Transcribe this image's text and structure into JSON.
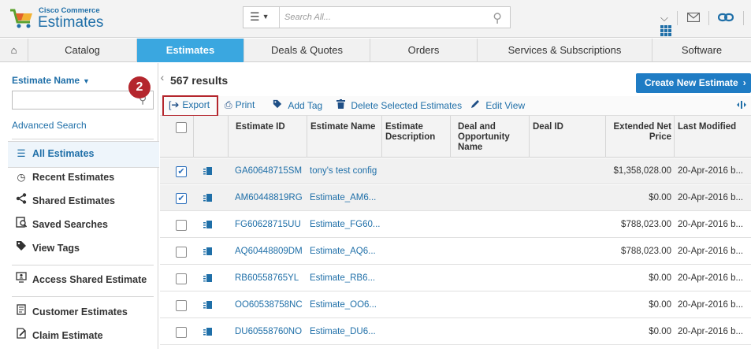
{
  "header": {
    "brand_small": "Cisco Commerce",
    "brand_title": "Estimates",
    "search_placeholder": "Search All..."
  },
  "nav": [
    "Catalog",
    "Estimates",
    "Deals & Quotes",
    "Orders",
    "Services & Subscriptions",
    "Software"
  ],
  "nav_active": "Estimates",
  "sidebar": {
    "filter_label": "Estimate Name",
    "advanced_search": "Advanced Search",
    "items": [
      {
        "label": "All Estimates",
        "icon": "list-icon"
      },
      {
        "label": "Recent Estimates",
        "icon": "clock-icon"
      },
      {
        "label": "Shared Estimates",
        "icon": "share-icon"
      },
      {
        "label": "Saved Searches",
        "icon": "saved-search-icon"
      },
      {
        "label": "View Tags",
        "icon": "tag-icon"
      },
      {
        "label": "Access Shared Estimate",
        "icon": "monitor-user-icon"
      },
      {
        "label": "Customer Estimates",
        "icon": "document-icon"
      },
      {
        "label": "Claim Estimate",
        "icon": "claim-icon"
      }
    ]
  },
  "results": {
    "count": "567 results",
    "create_button": "Create New Estimate",
    "step_badge": "2"
  },
  "toolbar": {
    "export": "Export",
    "print": "Print",
    "add_tag": "Add Tag",
    "delete": "Delete Selected Estimates",
    "edit_view": "Edit View"
  },
  "table": {
    "headers": {
      "estimate_id": "Estimate ID",
      "estimate_name": "Estimate Name",
      "estimate_description": "Estimate Description",
      "deal_opportunity": "Deal and Opportunity Name",
      "deal_id": "Deal ID",
      "net_price": "Extended Net Price",
      "last_modified": "Last Modified"
    },
    "rows": [
      {
        "id": "GA60648715SM",
        "name": "tony's test config",
        "price": "$1,358,028.00",
        "modified": "20-Apr-2016 b...",
        "checked": true
      },
      {
        "id": "AM60448819RG",
        "name": "Estimate_AM6...",
        "price": "$0.00",
        "modified": "20-Apr-2016 b...",
        "checked": true
      },
      {
        "id": "FG60628715UU",
        "name": "Estimate_FG60...",
        "price": "$788,023.00",
        "modified": "20-Apr-2016 b...",
        "checked": false
      },
      {
        "id": "AQ60448809DM",
        "name": "Estimate_AQ6...",
        "price": "$788,023.00",
        "modified": "20-Apr-2016 b...",
        "checked": false
      },
      {
        "id": "RB60558765YL",
        "name": "Estimate_RB6...",
        "price": "$0.00",
        "modified": "20-Apr-2016 b...",
        "checked": false
      },
      {
        "id": "OO60538758NC",
        "name": "Estimate_OO6...",
        "price": "$0.00",
        "modified": "20-Apr-2016 b...",
        "checked": false
      },
      {
        "id": "DU60558760NO",
        "name": "Estimate_DU6...",
        "price": "$0.00",
        "modified": "20-Apr-2016 b...",
        "checked": false
      }
    ]
  },
  "colors": {
    "accent_blue": "#3aa7e0",
    "link_blue": "#1f6fa8",
    "button_blue": "#1f7cc4",
    "highlight_red": "#b4262d"
  }
}
